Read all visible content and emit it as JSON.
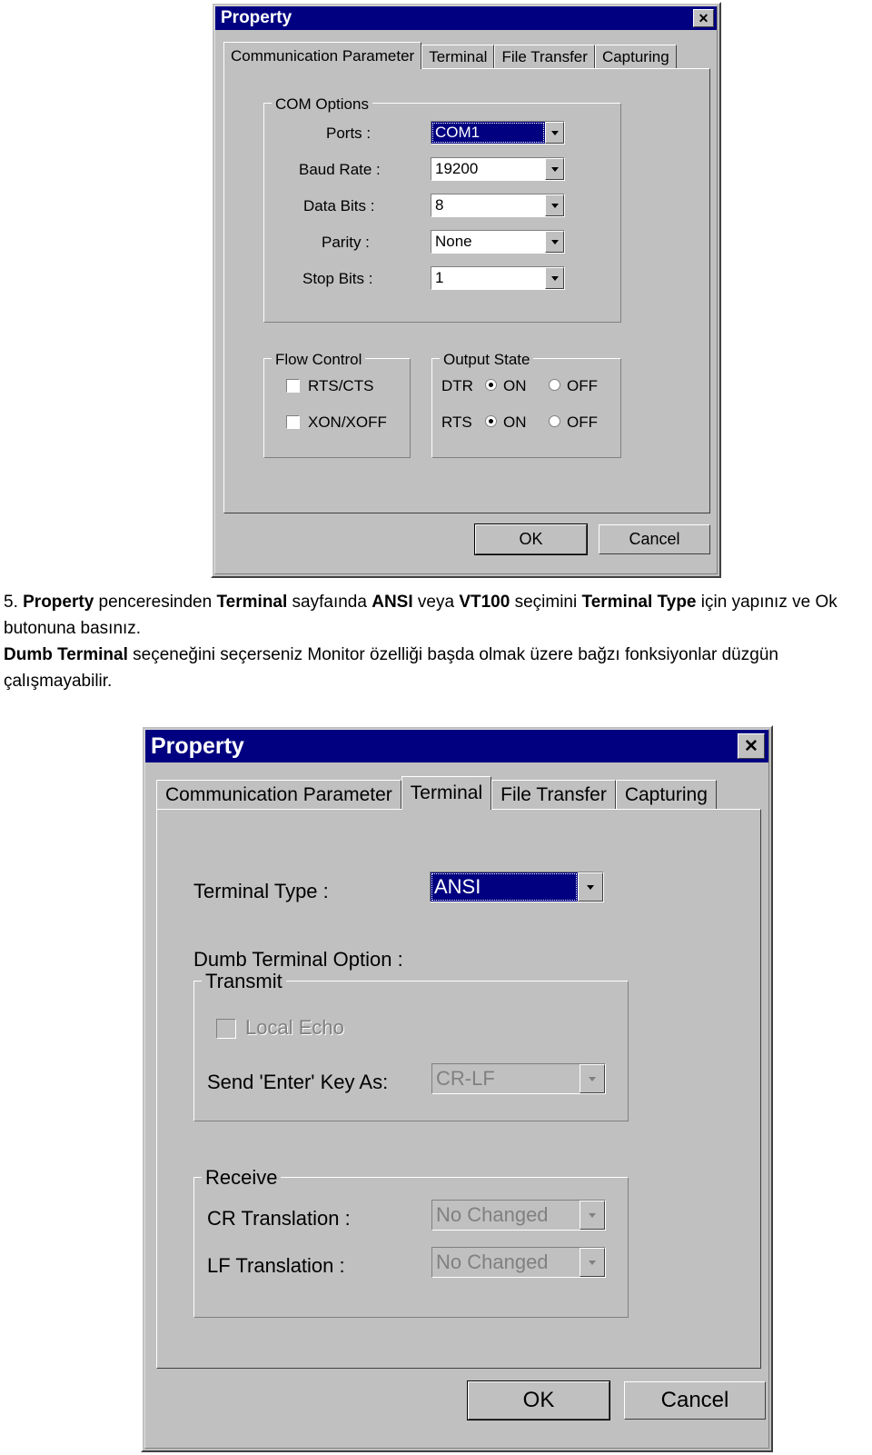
{
  "dialog1": {
    "title": "Property",
    "close_label": "✕",
    "tabs": [
      {
        "label": "Communication Parameter",
        "active": true
      },
      {
        "label": "Terminal",
        "active": false
      },
      {
        "label": "File Transfer",
        "active": false
      },
      {
        "label": "Capturing",
        "active": false
      }
    ],
    "com_options": {
      "group_title": "COM Options",
      "fields": [
        {
          "label": "Ports :",
          "value": "COM1",
          "selected": true
        },
        {
          "label": "Baud Rate :",
          "value": "19200",
          "selected": false
        },
        {
          "label": "Data Bits :",
          "value": "8",
          "selected": false
        },
        {
          "label": "Parity :",
          "value": "None",
          "selected": false
        },
        {
          "label": "Stop Bits :",
          "value": "1",
          "selected": false
        }
      ]
    },
    "flow_control": {
      "group_title": "Flow Control",
      "items": [
        {
          "label": "RTS/CTS",
          "checked": false
        },
        {
          "label": "XON/XOFF",
          "checked": false
        }
      ]
    },
    "output_state": {
      "group_title": "Output State",
      "rows": [
        {
          "label": "DTR",
          "on_label": "ON",
          "off_label": "OFF",
          "value": "ON"
        },
        {
          "label": "RTS",
          "on_label": "ON",
          "off_label": "OFF",
          "value": "ON"
        }
      ]
    },
    "buttons": {
      "ok": "OK",
      "cancel": "Cancel"
    }
  },
  "body_text": {
    "line1_num": "5. ",
    "line1_b1": "Property",
    "line1_t1": " penceresinden ",
    "line1_b2": "Terminal",
    "line1_t2": " sayfaında ",
    "line1_b3": "ANSI",
    "line1_t3": " veya ",
    "line1_b4": "VT100",
    "line1_t4": " seçimini ",
    "line1_b5": "Terminal Type",
    "line1_t5": " için yapınız ve Ok butonuna basınız.",
    "line2_b1": "Dumb Terminal",
    "line2_t1": " seçeneğini seçerseniz Monitor özelliği başda olmak üzere bağzı fonksiyonlar düzgün çalışmayabilir."
  },
  "dialog2": {
    "title": "Property",
    "close_label": "✕",
    "tabs": [
      {
        "label": "Communication Parameter",
        "active": false
      },
      {
        "label": "Terminal",
        "active": true
      },
      {
        "label": "File Transfer",
        "active": false
      },
      {
        "label": "Capturing",
        "active": false
      }
    ],
    "terminal_type": {
      "label": "Terminal Type :",
      "value": "ANSI",
      "selected": true
    },
    "dumb_option_label": "Dumb Terminal Option :",
    "transmit": {
      "group_title": "Transmit",
      "local_echo": {
        "label": "Local Echo",
        "checked": false,
        "disabled": true
      },
      "send_enter": {
        "label": "Send 'Enter' Key  As:",
        "value": "CR-LF",
        "disabled": true
      }
    },
    "receive": {
      "group_title": "Receive",
      "rows": [
        {
          "label": "CR Translation :",
          "value": "No Changed",
          "disabled": true
        },
        {
          "label": "LF Translation :",
          "value": "No Changed",
          "disabled": true
        }
      ]
    },
    "buttons": {
      "ok": "OK",
      "cancel": "Cancel"
    }
  },
  "colors": {
    "titlebar": "#000080",
    "face": "#c0c0c0",
    "highlight": "#000080",
    "disabled_text": "#808080"
  }
}
